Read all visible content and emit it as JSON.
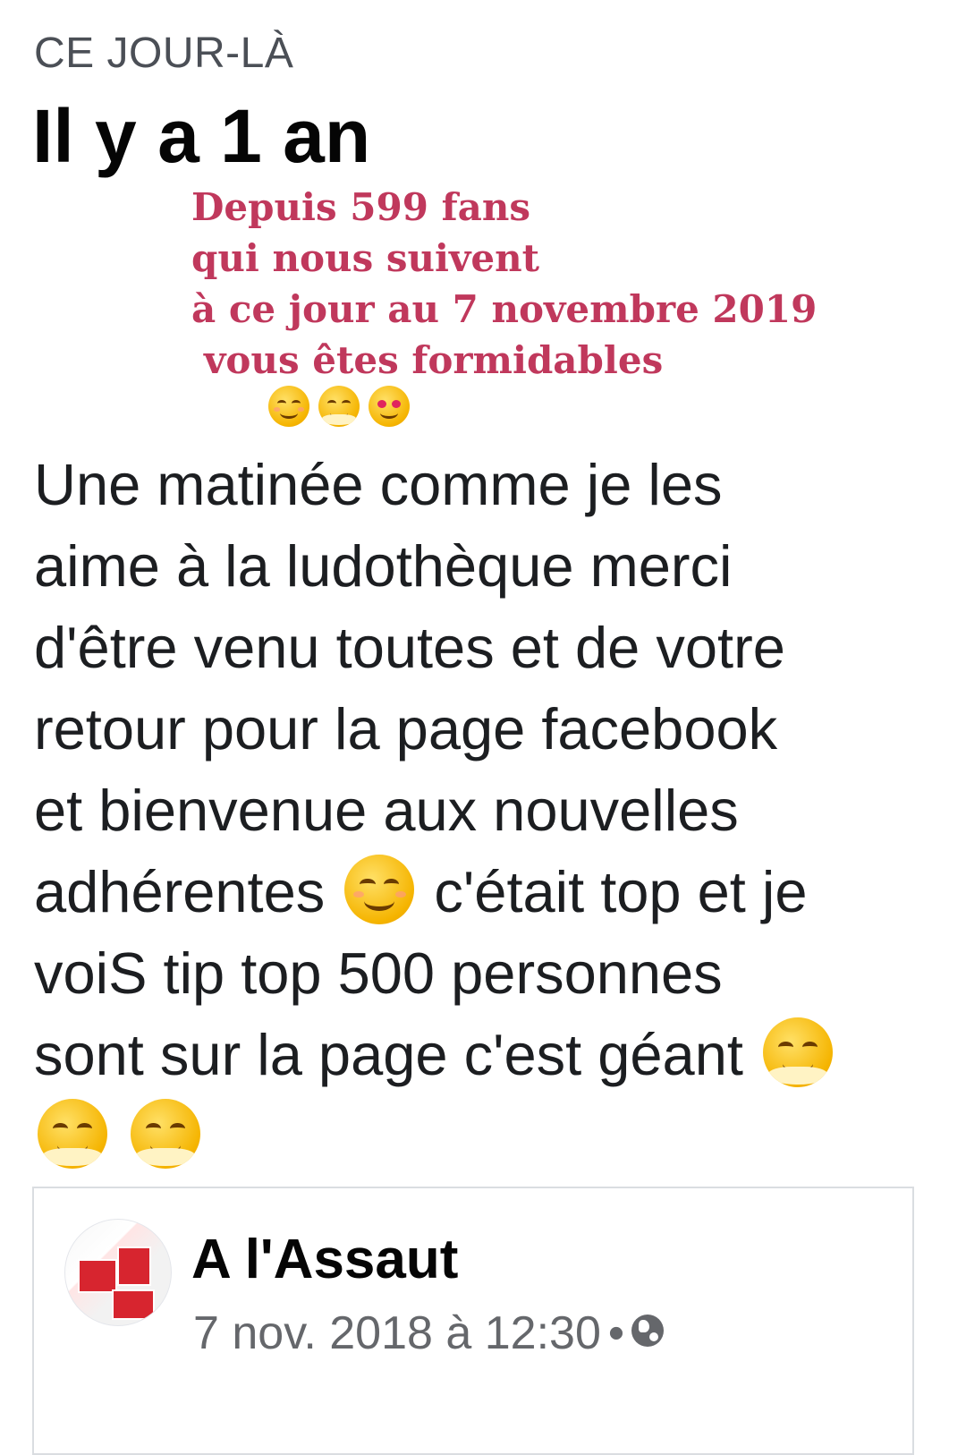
{
  "memory": {
    "label": "CE JOUR-LÀ",
    "title": "Il y a 1 an"
  },
  "overlay": {
    "lines": [
      "Depuis  599 fans",
      "qui nous suivent",
      "à ce jour au 7 novembre 2019",
      "vous êtes formidables"
    ],
    "emojis": [
      "smiling-face-icon",
      "hugging-face-icon",
      "heart-eyes-icon"
    ],
    "color": "#c0385c"
  },
  "post": {
    "lines": [
      "Une matinée comme je les",
      "aime à la ludothèque merci",
      "d'être venu toutes et de votre",
      "retour pour la page facebook",
      "et bienvenue aux nouvelles",
      "adhérentes",
      "c'était top et je",
      "voiS tip top 500 personnes",
      "sont sur la page c'est géant"
    ]
  },
  "shared_post": {
    "page_name": "A l'Assaut",
    "timestamp": "7 nov. 2018 à 12:30",
    "separator": "•",
    "privacy_icon": "globe-icon"
  }
}
